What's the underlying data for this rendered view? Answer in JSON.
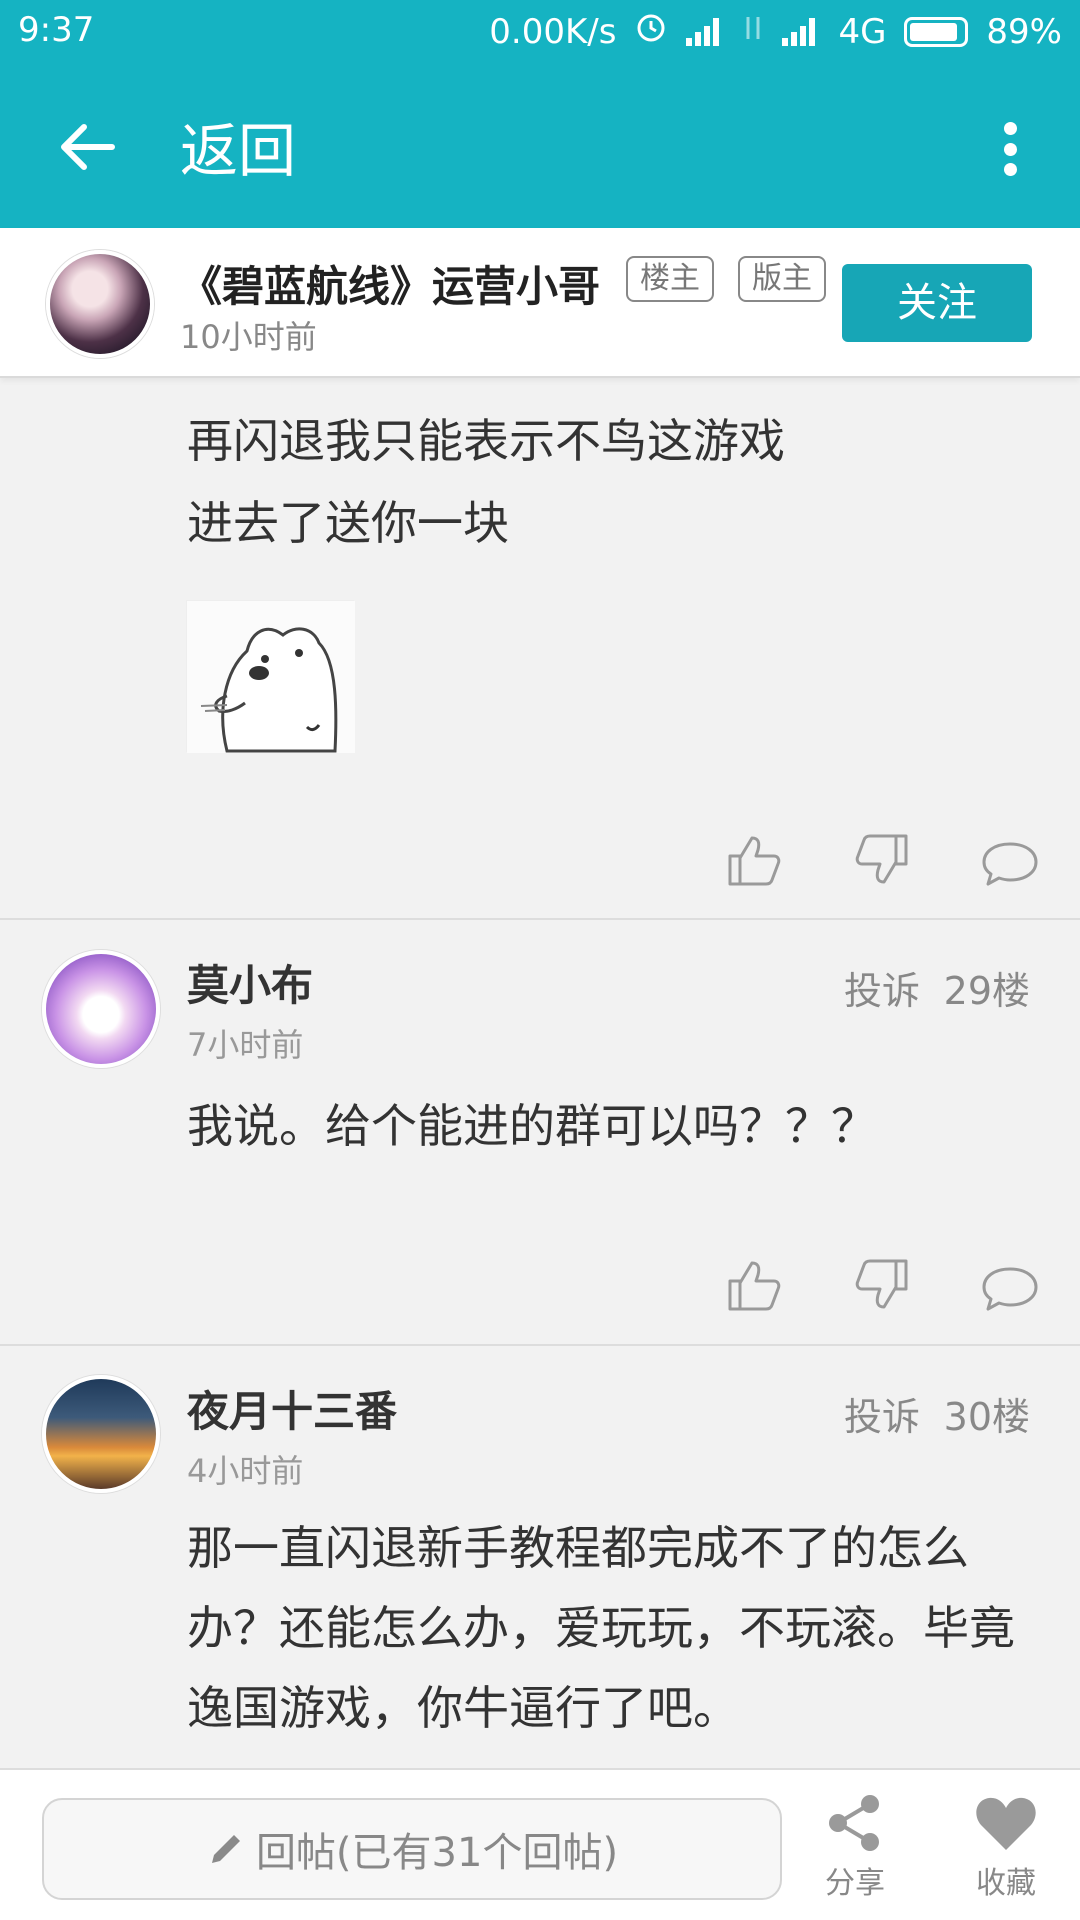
{
  "status_bar": {
    "time": "9:37",
    "net_speed": "0.00K/s",
    "network": "4G",
    "battery": "89%"
  },
  "app_bar": {
    "title": "返回"
  },
  "author": {
    "name": "《碧蓝航线》运营小哥",
    "tag_owner": "楼主",
    "tag_mod": "版主",
    "time": "10小时前",
    "follow_label": "关注"
  },
  "post": {
    "lines": [
      "再闪退我只能表示不鸟这游戏",
      "进去了送你一块"
    ]
  },
  "comments": [
    {
      "name": "莫小布",
      "time": "7小时前",
      "report": "投诉",
      "floor": "29楼",
      "text": "我说。给个能进的群可以吗？？？"
    },
    {
      "name": "夜月十三番",
      "time": "4小时前",
      "report": "投诉",
      "floor": "30楼",
      "text": "那一直闪退新手教程都完成不了的怎么办？还能怎么办，爱玩玩，不玩滚。毕竟逸国游戏，你牛逼行了吧。"
    }
  ],
  "bottom_bar": {
    "reply_placeholder": "回帖(已有31个回帖)",
    "share_label": "分享",
    "favorite_label": "收藏"
  },
  "colors": {
    "primary": "#15b3c2",
    "follow_button": "#17a6b6",
    "icon_gray": "#9a9a9a"
  }
}
